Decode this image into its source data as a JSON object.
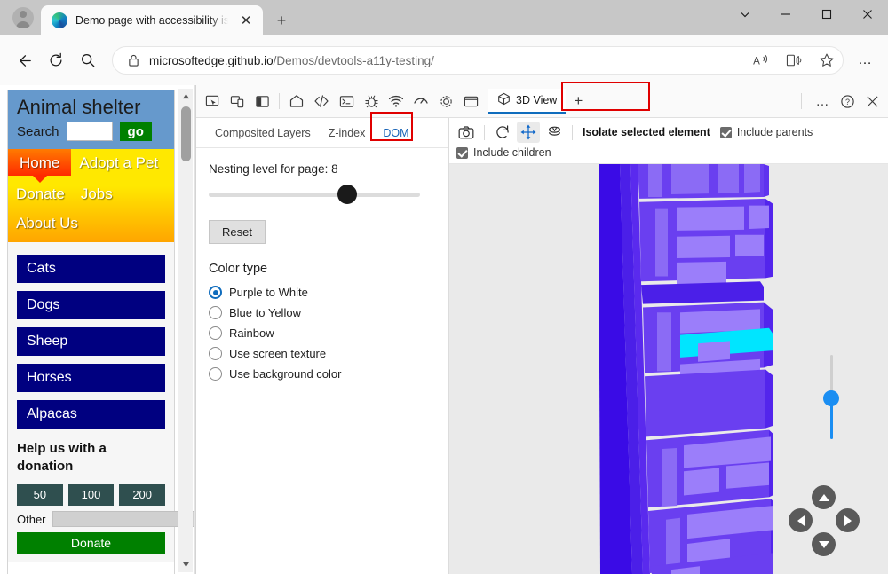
{
  "browser": {
    "tab": {
      "title": "Demo page with accessibility issu",
      "close_label": "✕"
    },
    "new_tab_label": "+",
    "window_controls": {
      "caret": "⌄",
      "minimize": "—",
      "maximize": "☐",
      "close": "✕"
    },
    "nav": {
      "back": "←",
      "refresh": "⟳",
      "search": "search-icon"
    },
    "url": {
      "prefix": "microsoftedge.github.io",
      "suffix": "/Demos/devtools-a11y-testing/",
      "lock": "lock-icon"
    },
    "url_actions": {
      "read_aloud": "A",
      "immersive_reader": "book-icon",
      "favorite": "☆"
    },
    "more_label": "…"
  },
  "webpage": {
    "title": "Animal shelter",
    "search_label": "Search",
    "search_value": "",
    "go_label": "go",
    "nav_items": [
      "Home",
      "Adopt a Pet",
      "Donate",
      "Jobs",
      "About Us"
    ],
    "animals": [
      "Cats",
      "Dogs",
      "Sheep",
      "Horses",
      "Alpacas"
    ],
    "help_title": "Help us with a donation",
    "amounts": [
      "50",
      "100",
      "200"
    ],
    "other_label": "Other",
    "other_value": "",
    "donate_label": "Donate"
  },
  "devtools": {
    "toolbar_icons": [
      "inspect-element-icon",
      "device-emulation-icon",
      "dock-side-icon",
      "welcome-home-icon",
      "elements-code-icon",
      "console-icon",
      "debugger-bug-icon",
      "network-icon",
      "performance-icon",
      "settings-gear-icon",
      "application-icon"
    ],
    "active_tab": {
      "label": "3D View",
      "icon": "cube-3d-icon"
    },
    "add_tab_label": "+",
    "more_tools_label": "…",
    "help_label": "?",
    "close_label": "✕",
    "subtabs": [
      {
        "label": "Composited Layers",
        "active": false
      },
      {
        "label": "Z-index",
        "active": false
      },
      {
        "label": "DOM",
        "active": true
      }
    ],
    "settings": {
      "nesting_label": "Nesting level for page: 8",
      "nesting_value": 8,
      "reset_label": "Reset",
      "color_type_title": "Color type",
      "color_options": [
        {
          "label": "Purple to White",
          "selected": true
        },
        {
          "label": "Blue to Yellow",
          "selected": false
        },
        {
          "label": "Rainbow",
          "selected": false
        },
        {
          "label": "Use screen texture",
          "selected": false
        },
        {
          "label": "Use background color",
          "selected": false
        }
      ]
    },
    "view_toolbar": {
      "icons": [
        "screenshot-camera-icon",
        "reset-view-icon",
        "pan-move-icon",
        "rotate-layers-icon"
      ],
      "isolate_label": "Isolate selected element",
      "include_parents_label": "Include parents",
      "include_parents_checked": true,
      "include_children_label": "Include children",
      "include_children_checked": true
    },
    "canvas": {
      "zoom_slider_name": "zoom-slider",
      "dpad": {
        "up": "pan-up",
        "down": "pan-down",
        "left": "pan-left",
        "right": "pan-right"
      },
      "colors": {
        "background": "#eaeaea",
        "slab_dark": "#4b1fe8",
        "slab_mid": "#6a3ff0",
        "slab_light": "#8b6bf5",
        "selected": "#00e5ff"
      }
    }
  },
  "highlights": {
    "color": "#e00000"
  }
}
